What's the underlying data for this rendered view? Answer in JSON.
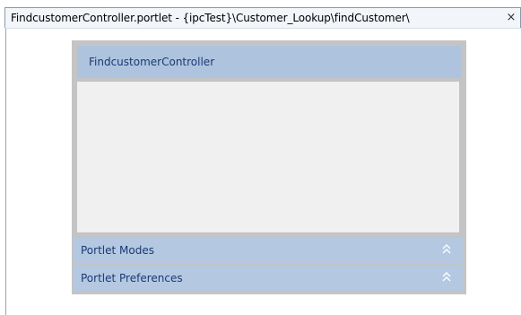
{
  "editor_tab": {
    "title": "FindcustomerController.portlet - {ipcTest}\\Customer_Lookup\\findCustomer\\",
    "close_label": "×"
  },
  "portlet": {
    "name": "FindcustomerController"
  },
  "sections": {
    "modes": {
      "label": "Portlet Modes",
      "icon": "chevron-double-up-icon"
    },
    "preferences": {
      "label": "Portlet Preferences",
      "icon": "chevron-double-up-icon"
    }
  },
  "colors": {
    "frame": "#c4c4c4",
    "header_fill": "#aec4de",
    "section_fill": "#b4c8e2",
    "text_blue": "#1a3a72",
    "body_fill": "#f0f0f0"
  }
}
